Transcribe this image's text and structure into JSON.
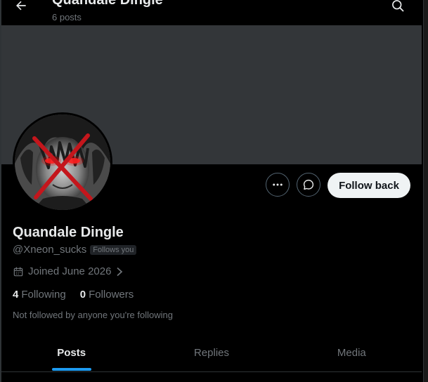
{
  "header": {
    "title": "Quandale Dingle",
    "post_count": "6 posts",
    "back_icon": "arrow-left-icon",
    "search_icon": "search-icon"
  },
  "profile": {
    "display_name": "Quandale Dingle",
    "handle": "@Xneon_sucks",
    "follows_you_badge": "Follows you",
    "joined": "Joined June 2026",
    "following_count": "4",
    "following_label": "Following",
    "followers_count": "0",
    "followers_label": "Followers",
    "social_context": "Not followed by anyone you're following"
  },
  "actions": {
    "more_icon": "more-horizontal-icon",
    "message_icon": "message-bubble-icon",
    "follow_back_label": "Follow back"
  },
  "tabs": [
    {
      "label": "Posts",
      "active": true
    },
    {
      "label": "Replies",
      "active": false
    },
    {
      "label": "Media",
      "active": false
    }
  ],
  "colors": {
    "background": "#000000",
    "banner": "#333639",
    "accent": "#1d9bf0",
    "text_primary": "#e7e9ea",
    "text_secondary": "#71767b",
    "follow_button_bg": "#eff3f4"
  }
}
